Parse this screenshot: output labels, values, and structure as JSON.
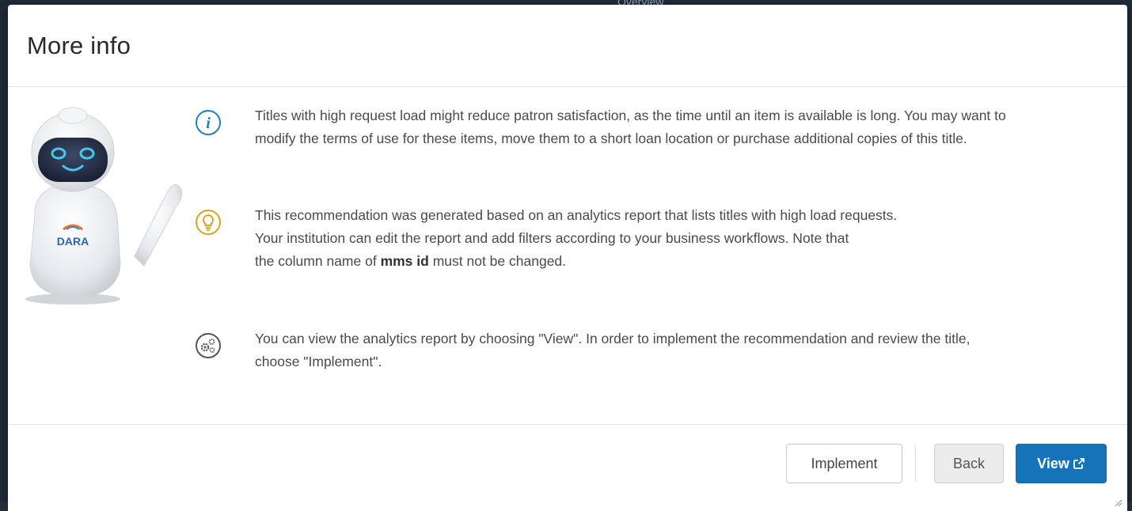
{
  "background": {
    "partial_text": "Overview"
  },
  "modal": {
    "title": "More info",
    "mascot": {
      "brand_label": "DARA"
    },
    "rows": [
      {
        "icon": "info-icon",
        "icon_color": "#1f7fc4",
        "paragraphs": [
          "Titles with high request load might reduce patron satisfaction, as the time until an item is available is long. You may want to modify the terms of use for these items, move them to a short loan location or purchase additional copies of this title."
        ]
      },
      {
        "icon": "lightbulb-icon",
        "icon_color": "#e0a21e",
        "paragraphs": [
          "This recommendation was generated based on an analytics report that lists titles with high load requests.",
          "Your institution can edit the report and add filters according to your business workflows. Note that"
        ],
        "bold_prefix": "the column name of ",
        "bold_text": "mms id",
        "bold_suffix": " must not be changed."
      },
      {
        "icon": "gears-icon",
        "icon_color": "#555555",
        "paragraphs": [
          "You can view the analytics report by choosing \"View\". In order to implement the recommendation and review the title, choose \"Implement\"."
        ]
      }
    ],
    "footer": {
      "implement_label": "Implement",
      "back_label": "Back",
      "view_label": "View"
    }
  },
  "colors": {
    "primary": "#1574b9",
    "text": "#4a4a4a"
  }
}
